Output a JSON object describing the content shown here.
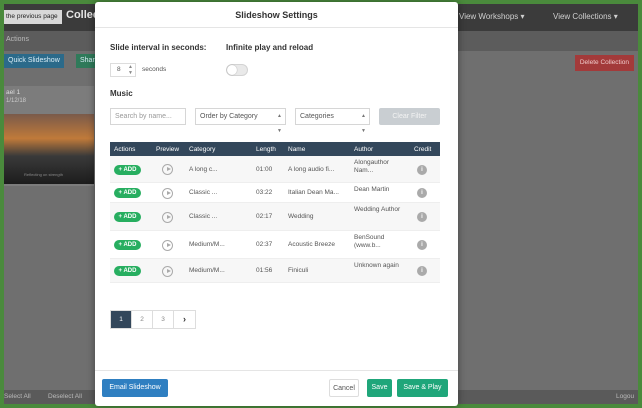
{
  "background": {
    "prev_page": "the previous page",
    "title": "Collect",
    "menu_workshops": "View Workshops ▾",
    "menu_collections": "View Collections ▾",
    "subbar_label": "Actions",
    "quick_slideshow": "Quick Slideshow",
    "share": "Shar",
    "delete_collection": "Delete Collection",
    "card_title": "ael 1",
    "card_date": "1/12/18",
    "card_caption": "Reflecting on strength",
    "footer_select_all": "Select All",
    "footer_deselect_all": "Deselect All",
    "footer_logout": "Logou"
  },
  "modal": {
    "title": "Slideshow Settings",
    "interval_label": "Slide interval in seconds:",
    "interval_value": "8",
    "interval_unit": "seconds",
    "infinite_label": "Infinite play and reload",
    "infinite_enabled": false,
    "music_label": "Music",
    "search_placeholder": "Search by name...",
    "order_select": "Order by Category",
    "category_select": "Categories",
    "clear_filter": "Clear Filter",
    "table": {
      "headers": [
        "Actions",
        "Preview",
        "Category",
        "Length",
        "Name",
        "Author",
        "Credit"
      ],
      "add_label": "+ ADD",
      "rows": [
        {
          "category": "A long c...",
          "length": "01:00",
          "name": "A long audio fi...",
          "author": "Alongauthor Nam..."
        },
        {
          "category": "Classic ...",
          "length": "03:22",
          "name": "Italian Dean Ma...",
          "author": "Dean Martin"
        },
        {
          "category": "Classic ...",
          "length": "02:17",
          "name": "Wedding",
          "author": "Wedding Author"
        },
        {
          "category": "Medium/M...",
          "length": "02:37",
          "name": "Acoustic Breeze",
          "author": "BenSound (www.b..."
        },
        {
          "category": "Medium/M...",
          "length": "01:56",
          "name": "Finiculi",
          "author": "Unknown again"
        }
      ]
    },
    "pagination": [
      "1",
      "2",
      "3",
      "›"
    ],
    "footer": {
      "email": "Email Slideshow",
      "cancel": "Cancel",
      "save": "Save",
      "save_play": "Save & Play"
    }
  }
}
